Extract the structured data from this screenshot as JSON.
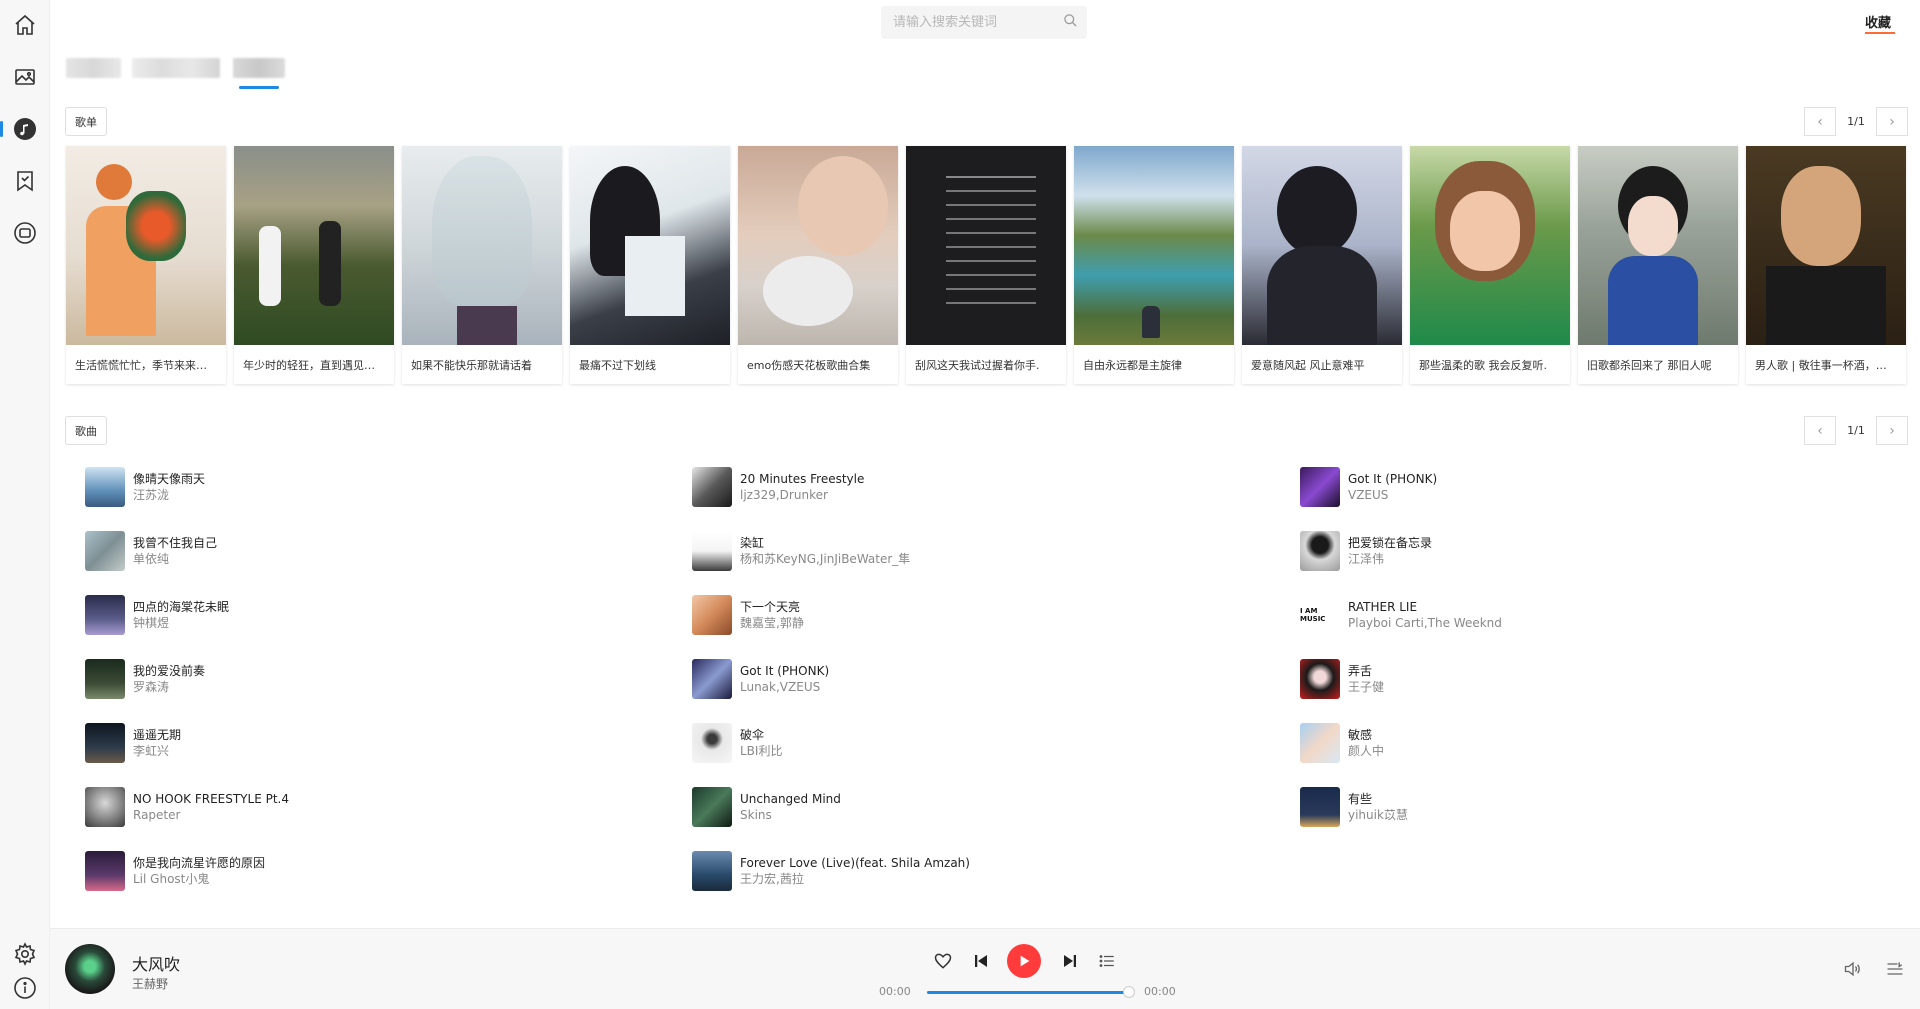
{
  "search": {
    "placeholder": "请输入搜索关键词"
  },
  "header": {
    "favorites_label": "收藏"
  },
  "sections": {
    "playlists_label": "歌单",
    "songs_label": "歌曲",
    "playlists_page": "1/1",
    "songs_page": "1/1"
  },
  "playlists": [
    {
      "title": "生活慌慌忙忙，季节来来往往"
    },
    {
      "title": "年少时的轻狂，直到遇见你才停下"
    },
    {
      "title": "如果不能快乐那就请话着"
    },
    {
      "title": "最痛不过下划线"
    },
    {
      "title": "emo伤感天花板歌曲合集"
    },
    {
      "title": "刮风这天我试过握着你手."
    },
    {
      "title": "自由永远都是主旋律"
    },
    {
      "title": "爱意随风起 风止意难平"
    },
    {
      "title": "那些温柔的歌 我会反复听."
    },
    {
      "title": "旧歌都杀回来了 那旧人呢"
    },
    {
      "title": "男人歌 | 敬往事一杯酒，再爱也不回头"
    }
  ],
  "songs": {
    "col1": [
      {
        "name": "像晴天像雨天",
        "artist": "汪苏泷"
      },
      {
        "name": "我曾不住我自己",
        "artist": "单依纯"
      },
      {
        "name": "四点的海棠花未眠",
        "artist": "钟棋煜"
      },
      {
        "name": "我的爱没前奏",
        "artist": "罗森涛"
      },
      {
        "name": "遥遥无期",
        "artist": "李虹兴"
      },
      {
        "name": "NO HOOK FREESTYLE Pt.4",
        "artist": "Rapeter"
      },
      {
        "name": "你是我向流星许愿的原因",
        "artist": "Lil Ghost小鬼"
      }
    ],
    "col2": [
      {
        "name": "20 Minutes Freestyle",
        "artist": "ljz329,Drunker"
      },
      {
        "name": "染缸",
        "artist": "杨和苏KeyNG,JinJiBeWater_隼"
      },
      {
        "name": "下一个天亮",
        "artist": "魏嘉莹,郭静"
      },
      {
        "name": "Got It (PHONK)",
        "artist": "Lunak,VZEUS"
      },
      {
        "name": "破伞",
        "artist": "LBI利比"
      },
      {
        "name": "Unchanged Mind",
        "artist": "Skins"
      },
      {
        "name": "Forever Love (Live)(feat. Shila Amzah)",
        "artist": "王力宏,茜拉"
      }
    ],
    "col3": [
      {
        "name": "Got It (PHONK)",
        "artist": "VZEUS"
      },
      {
        "name": "把爱锁在备忘录",
        "artist": "江泽伟"
      },
      {
        "name": "RATHER LIE",
        "artist": "Playboi Carti,The Weeknd"
      },
      {
        "name": "弄舌",
        "artist": "王子健"
      },
      {
        "name": "敏感",
        "artist": "颜人中"
      },
      {
        "name": "有些",
        "artist": "yihuik苡慧"
      }
    ]
  },
  "player": {
    "title": "大风吹",
    "artist": "王赫野",
    "current_time": "00:00",
    "total_time": "00:00",
    "progress": 1.0
  },
  "colors": {
    "accent": "#1e88e5",
    "play": "#ff3b3b",
    "fav_underline": "#ff6b35"
  }
}
